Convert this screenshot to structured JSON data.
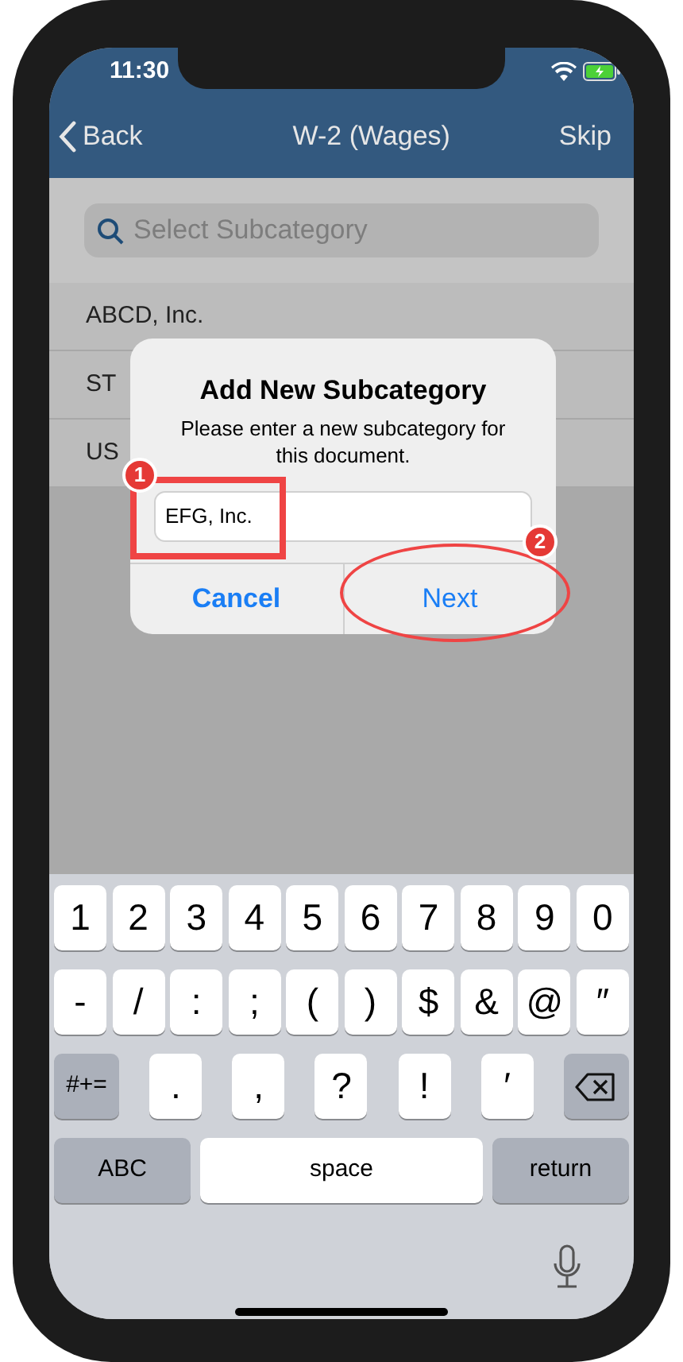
{
  "status_bar": {
    "time": "11:30"
  },
  "nav": {
    "back": "Back",
    "title": "W-2 (Wages)",
    "action": "Skip"
  },
  "search": {
    "placeholder": "Select Subcategory"
  },
  "list": [
    "ABCD, Inc.",
    "ST",
    "US"
  ],
  "dialog": {
    "title": "Add New Subcategory",
    "message": "Please enter a new subcategory for this document.",
    "input": {
      "value": "EFG, Inc."
    },
    "buttons": [
      {
        "label": "Cancel",
        "bold": true
      },
      {
        "label": "Next",
        "bold": false
      }
    ]
  },
  "annotations": [
    {
      "kind": "rect",
      "number": "1"
    },
    {
      "kind": "ellipse",
      "number": "2"
    }
  ],
  "keyboard": [
    [
      {
        "kind": "char",
        "label": "1"
      },
      {
        "kind": "char",
        "label": "2"
      },
      {
        "kind": "char",
        "label": "3"
      },
      {
        "kind": "char",
        "label": "4"
      },
      {
        "kind": "char",
        "label": "5"
      },
      {
        "kind": "char",
        "label": "6"
      },
      {
        "kind": "char",
        "label": "7"
      },
      {
        "kind": "char",
        "label": "8"
      },
      {
        "kind": "char",
        "label": "9"
      },
      {
        "kind": "char",
        "label": "0"
      }
    ],
    [
      {
        "kind": "char",
        "label": "-"
      },
      {
        "kind": "char",
        "label": "/"
      },
      {
        "kind": "char",
        "label": ":"
      },
      {
        "kind": "char",
        "label": ";"
      },
      {
        "kind": "char",
        "label": "("
      },
      {
        "kind": "char",
        "label": ")"
      },
      {
        "kind": "char",
        "label": "$"
      },
      {
        "kind": "char",
        "label": "&"
      },
      {
        "kind": "char",
        "label": "@"
      },
      {
        "kind": "char",
        "label": "″"
      }
    ],
    [
      {
        "kind": "function",
        "label": "#+="
      },
      {
        "kind": "char",
        "label": "."
      },
      {
        "kind": "char",
        "label": ","
      },
      {
        "kind": "char",
        "label": "?"
      },
      {
        "kind": "char",
        "label": "!"
      },
      {
        "kind": "char",
        "label": "′"
      },
      {
        "kind": "delete"
      }
    ],
    [
      {
        "kind": "function",
        "label": "ABC"
      },
      {
        "kind": "space",
        "label": "space"
      },
      {
        "kind": "function",
        "label": "return"
      }
    ]
  ]
}
